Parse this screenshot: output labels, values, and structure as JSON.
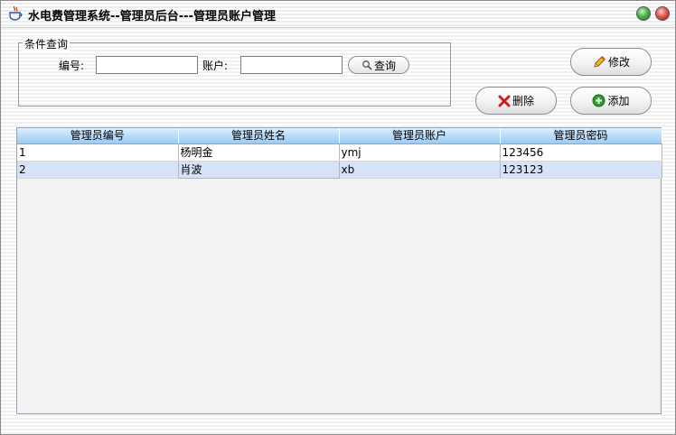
{
  "window": {
    "title": "水电费管理系统--管理员后台---管理员账户管理",
    "icons": {
      "app": "java-cup-icon",
      "minimize": "green-circle-icon",
      "close": "red-circle-icon"
    }
  },
  "query": {
    "legend": "条件查询",
    "id_label": "编号:",
    "id_value": "",
    "account_label": "账户:",
    "account_value": "",
    "search_button": "查询"
  },
  "toolbar": {
    "edit_label": "修改",
    "delete_label": "删除",
    "add_label": "添加"
  },
  "table": {
    "columns": [
      "管理员编号",
      "管理员姓名",
      "管理员账户",
      "管理员密码"
    ],
    "rows": [
      [
        "1",
        "杨明金",
        "ymj",
        "123456"
      ],
      [
        "2",
        "肖波",
        "xb",
        "123123"
      ]
    ]
  },
  "colors": {
    "header_gradient_top": "#dff0ff",
    "header_gradient_bottom": "#9ccbf3",
    "selected_row": "#d5e2f7",
    "focus_cell_border": "#e0b050"
  }
}
